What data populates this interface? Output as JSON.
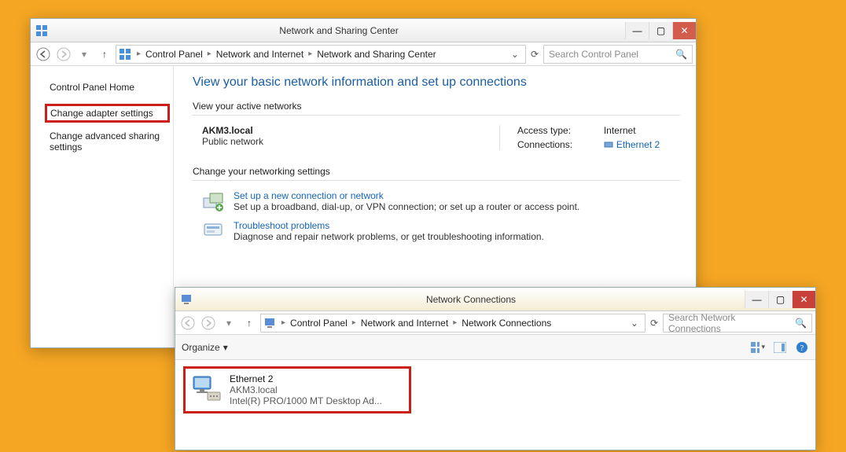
{
  "window1": {
    "title": "Network and Sharing Center",
    "breadcrumb": [
      "Control Panel",
      "Network and Internet",
      "Network and Sharing Center"
    ],
    "search_placeholder": "Search Control Panel",
    "sidebar": {
      "home": "Control Panel Home",
      "change_adapter": "Change adapter settings",
      "change_advanced": "Change advanced sharing settings"
    },
    "main": {
      "title": "View your basic network information and set up connections",
      "active_label": "View your active networks",
      "network": {
        "name": "AKM3.local",
        "type": "Public network",
        "access_label": "Access type:",
        "access_value": "Internet",
        "conn_label": "Connections:",
        "conn_value": "Ethernet 2"
      },
      "change_label": "Change your networking settings",
      "task_setup": {
        "title": "Set up a new connection or network",
        "desc": "Set up a broadband, dial-up, or VPN connection; or set up a router or access point."
      },
      "task_trouble": {
        "title": "Troubleshoot problems",
        "desc": "Diagnose and repair network problems, or get troubleshooting information."
      }
    }
  },
  "window2": {
    "title": "Network Connections",
    "breadcrumb": [
      "Control Panel",
      "Network and Internet",
      "Network Connections"
    ],
    "search_placeholder": "Search Network Connections",
    "organize": "Organize",
    "adapter": {
      "name": "Ethernet 2",
      "network": "AKM3.local",
      "device": "Intel(R) PRO/1000 MT Desktop Ad..."
    }
  }
}
